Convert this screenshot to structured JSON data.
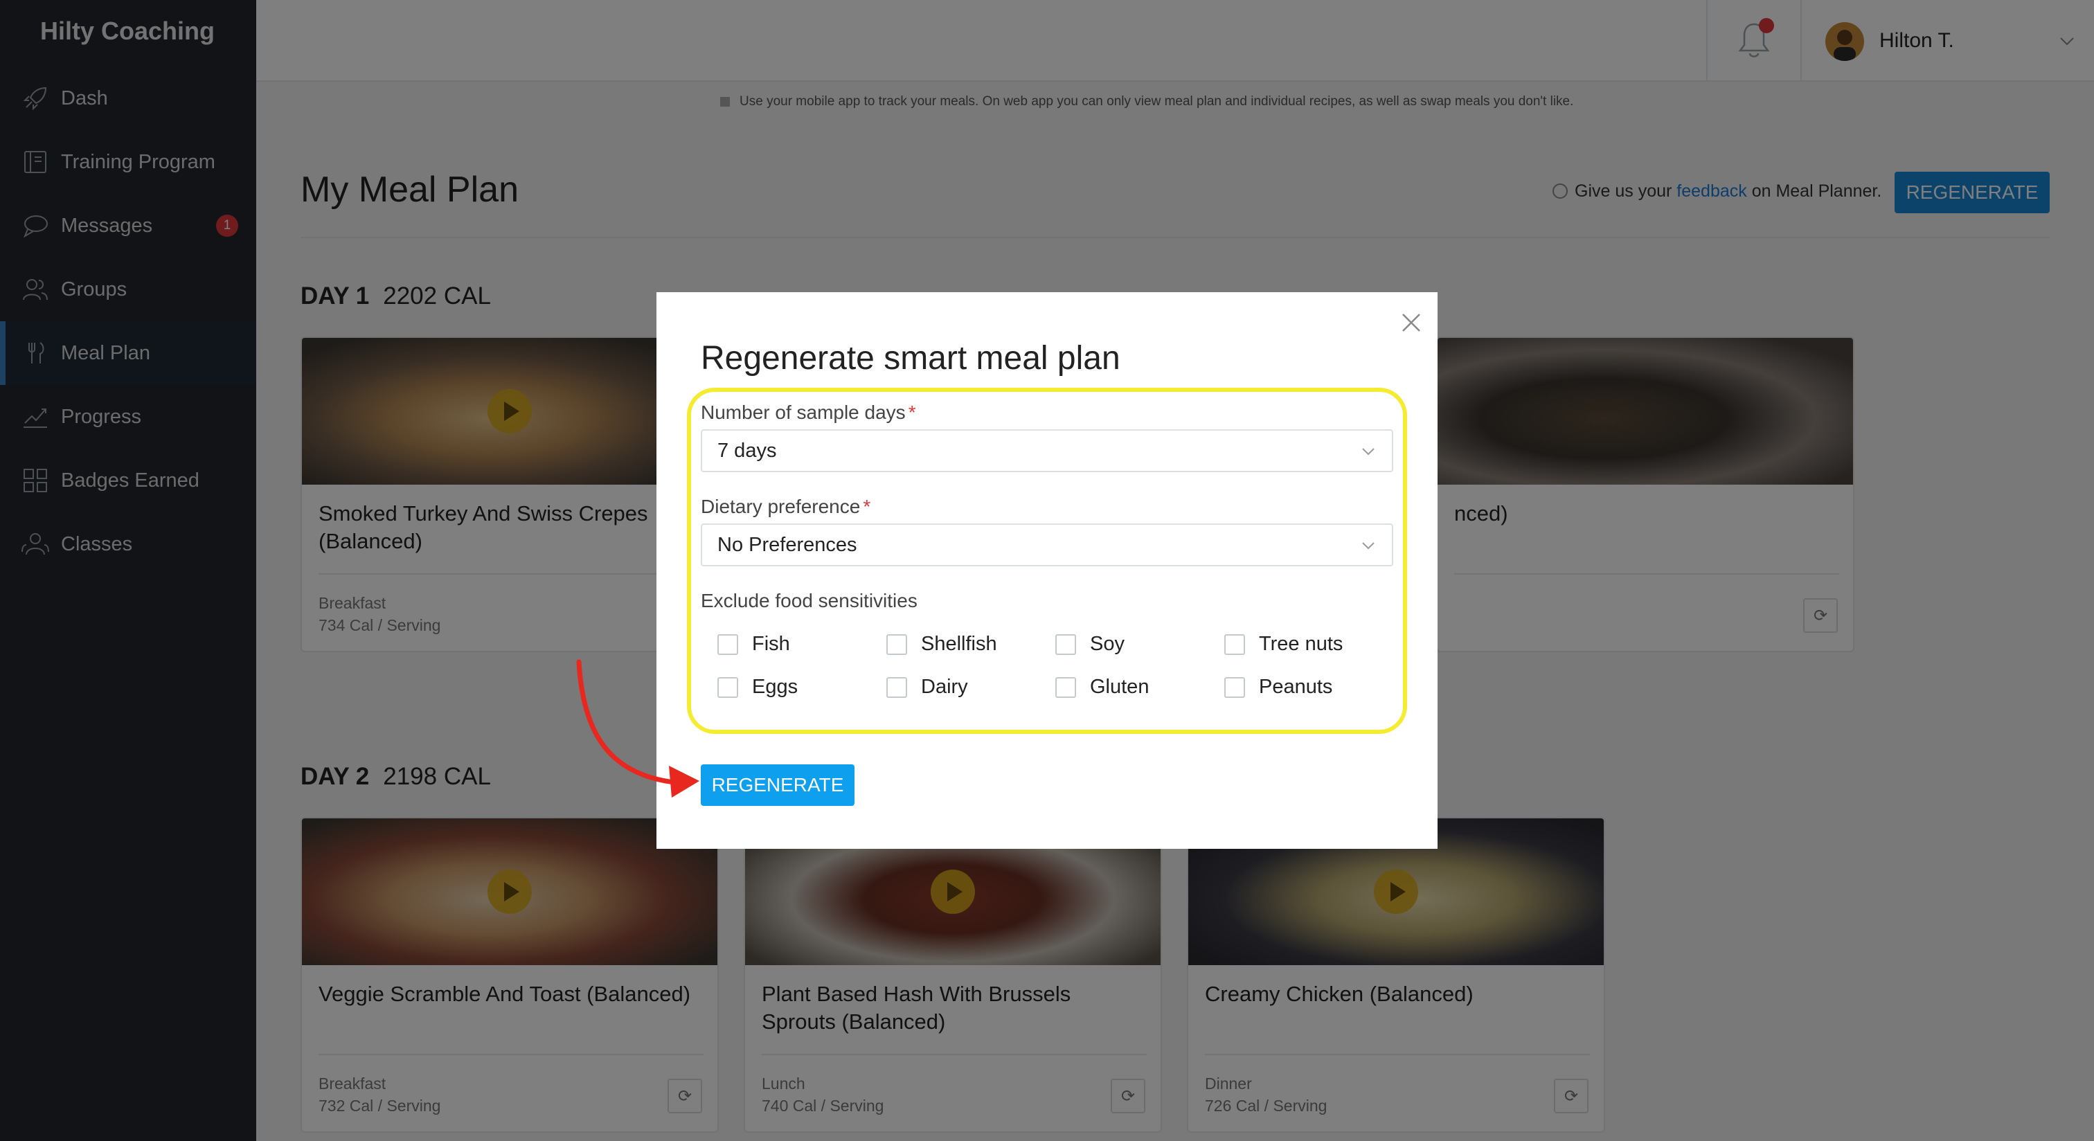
{
  "brand": "Hilty Coaching",
  "nav": [
    {
      "label": "Dash",
      "icon": "rocket-icon"
    },
    {
      "label": "Training Program",
      "icon": "book-icon"
    },
    {
      "label": "Messages",
      "icon": "chat-icon",
      "badge": "1"
    },
    {
      "label": "Groups",
      "icon": "people-icon"
    },
    {
      "label": "Meal Plan",
      "icon": "fork-knife-icon",
      "active": true
    },
    {
      "label": "Progress",
      "icon": "chart-icon"
    },
    {
      "label": "Badges Earned",
      "icon": "grid-icon"
    },
    {
      "label": "Classes",
      "icon": "group-icon"
    }
  ],
  "user": {
    "name": "Hilton T."
  },
  "info_text": "Use your mobile app to track your meals. On web app you can only view meal plan and individual recipes, as well as swap meals you don't like.",
  "page": {
    "title": "My Meal Plan",
    "feedback_prefix": "Give us your ",
    "feedback_link": "feedback",
    "feedback_suffix": " on Meal Planner.",
    "regenerate_label": "REGENERATE"
  },
  "days": [
    {
      "label": "DAY 1",
      "calories": "2202 CAL",
      "meals": [
        {
          "title": "Smoked Turkey And Swiss Crepes (Balanced)",
          "type": "Breakfast",
          "cal": "734 Cal / Serving"
        },
        {
          "title": "",
          "type": "",
          "cal": ""
        },
        {
          "title": "nced)",
          "type": "",
          "cal": ""
        }
      ]
    },
    {
      "label": "DAY 2",
      "calories": "2198 CAL",
      "meals": [
        {
          "title": "Veggie Scramble And Toast (Balanced)",
          "type": "Breakfast",
          "cal": "732 Cal / Serving"
        },
        {
          "title": "Plant Based Hash With Brussels Sprouts (Balanced)",
          "type": "Lunch",
          "cal": "740 Cal / Serving"
        },
        {
          "title": "Creamy Chicken (Balanced)",
          "type": "Dinner",
          "cal": "726 Cal / Serving"
        }
      ]
    }
  ],
  "modal": {
    "title": "Regenerate smart meal plan",
    "days_label": "Number of sample days",
    "days_value": "7 days",
    "diet_label": "Dietary preference",
    "diet_value": "No Preferences",
    "exclude_label": "Exclude food sensitivities",
    "sensitivities": [
      "Fish",
      "Shellfish",
      "Soy",
      "Tree nuts",
      "Eggs",
      "Dairy",
      "Gluten",
      "Peanuts"
    ],
    "regenerate_label": "REGENERATE",
    "required_mark": "*"
  },
  "colors": {
    "sidebar_bg": "#23272f",
    "accent_blue": "#1787d6",
    "modal_button": "#0ea0ee",
    "highlight": "#f5ec32",
    "annotation_arrow": "#e8271e",
    "badge_red": "#e0393e"
  }
}
